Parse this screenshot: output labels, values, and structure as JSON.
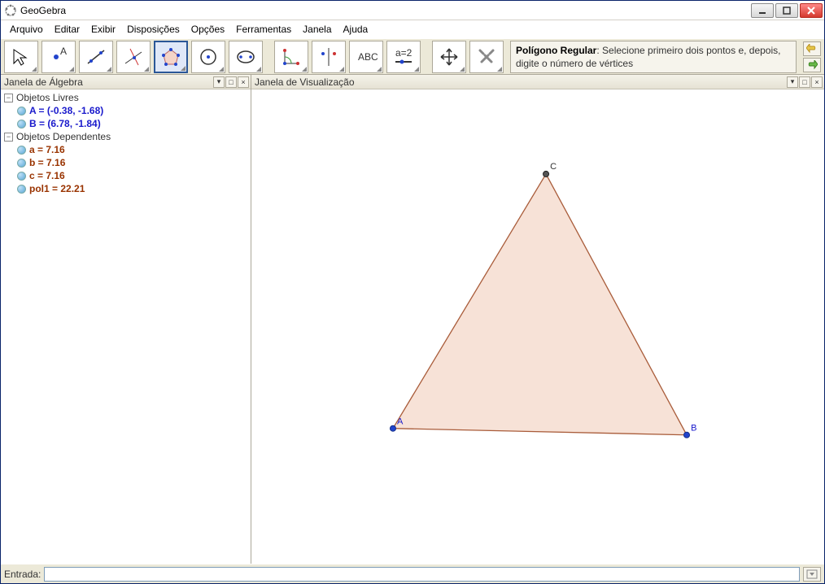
{
  "title": "GeoGebra",
  "menus": [
    "Arquivo",
    "Editar",
    "Exibir",
    "Disposições",
    "Opções",
    "Ferramentas",
    "Janela",
    "Ajuda"
  ],
  "tooltip_title": "Polígono Regular",
  "tooltip_body": ": Selecione primeiro dois pontos e, depois, digite o número de vértices",
  "panel_algebra_title": "Janela de Álgebra",
  "panel_view_title": "Janela de Visualização",
  "tree": {
    "free_label": "Objetos Livres",
    "dep_label": "Objetos Dependentes",
    "free": [
      {
        "text": "A = (-0.38, -1.68)"
      },
      {
        "text": "B = (6.78, -1.84)"
      }
    ],
    "dep": [
      {
        "text": "a = 7.16"
      },
      {
        "text": "b = 7.16"
      },
      {
        "text": "c = 7.16"
      },
      {
        "text": "pol1 = 22.21"
      }
    ]
  },
  "input_label": "Entrada:",
  "input_value": "",
  "points": {
    "A": {
      "label": "A"
    },
    "B": {
      "label": "B"
    },
    "C": {
      "label": "C"
    }
  },
  "chart_data": {
    "type": "other",
    "description": "Equilateral triangle ABC in GeoGebra view",
    "vertices": {
      "A": {
        "x": -0.38,
        "y": -1.68
      },
      "B": {
        "x": 6.78,
        "y": -1.84
      },
      "C": {
        "x_estimated": 3.06,
        "y_estimated": 4.53
      }
    },
    "sides": {
      "a": 7.16,
      "b": 7.16,
      "c": 7.16
    },
    "area_pol1": 22.21
  }
}
